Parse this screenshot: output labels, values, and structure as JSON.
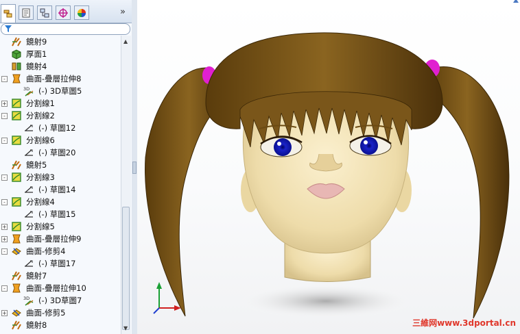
{
  "feature_tree": {
    "tabs": [
      {
        "name": "feature-manager-tab",
        "active": true
      },
      {
        "name": "property-manager-tab",
        "active": false
      },
      {
        "name": "configuration-manager-tab",
        "active": false
      },
      {
        "name": "dimxpert-manager-tab",
        "active": false
      },
      {
        "name": "display-manager-tab",
        "active": false
      }
    ],
    "more_label": "»",
    "items": [
      {
        "label": "鏡射9",
        "icon": "mirror-icon",
        "expander": null,
        "indent": 0
      },
      {
        "label": "厚面1",
        "icon": "thicken-icon",
        "expander": null,
        "indent": 0
      },
      {
        "label": "鏡射4",
        "icon": "mirror-body-icon",
        "expander": null,
        "indent": 0
      },
      {
        "label": "曲面-疊層拉伸8",
        "icon": "surface-loft-icon",
        "expander": "-",
        "indent": 0
      },
      {
        "label": "(-) 3D草圖5",
        "icon": "3d-sketch-icon",
        "expander": null,
        "indent": 1
      },
      {
        "label": "分割線1",
        "icon": "split-line-icon",
        "expander": "+",
        "indent": 0
      },
      {
        "label": "分割線2",
        "icon": "split-line-icon",
        "expander": "-",
        "indent": 0
      },
      {
        "label": "(-) 草圖12",
        "icon": "sketch-icon",
        "expander": null,
        "indent": 1
      },
      {
        "label": "分割線6",
        "icon": "split-line-icon",
        "expander": "-",
        "indent": 0
      },
      {
        "label": "(-) 草圖20",
        "icon": "sketch-icon",
        "expander": null,
        "indent": 1
      },
      {
        "label": "鏡射5",
        "icon": "mirror-icon",
        "expander": null,
        "indent": 0
      },
      {
        "label": "分割線3",
        "icon": "split-line-icon",
        "expander": "-",
        "indent": 0
      },
      {
        "label": "(-) 草圖14",
        "icon": "sketch-icon",
        "expander": null,
        "indent": 1
      },
      {
        "label": "分割線4",
        "icon": "split-line-icon",
        "expander": "-",
        "indent": 0
      },
      {
        "label": "(-) 草圖15",
        "icon": "sketch-icon",
        "expander": null,
        "indent": 1
      },
      {
        "label": "分割線5",
        "icon": "split-line-icon",
        "expander": "+",
        "indent": 0
      },
      {
        "label": "曲面-疊層拉伸9",
        "icon": "surface-loft-icon",
        "expander": "+",
        "indent": 0
      },
      {
        "label": "曲面-修剪4",
        "icon": "surface-trim-icon",
        "expander": "-",
        "indent": 0
      },
      {
        "label": "(-) 草圖17",
        "icon": "sketch-icon",
        "expander": null,
        "indent": 1
      },
      {
        "label": "鏡射7",
        "icon": "mirror-icon",
        "expander": null,
        "indent": 0
      },
      {
        "label": "曲面-疊層拉伸10",
        "icon": "surface-loft-icon",
        "expander": "-",
        "indent": 0
      },
      {
        "label": "(-) 3D草圖7",
        "icon": "3d-sketch-icon",
        "expander": null,
        "indent": 1
      },
      {
        "label": "曲面-修剪5",
        "icon": "surface-trim-icon",
        "expander": "+",
        "indent": 0
      },
      {
        "label": "鏡射8",
        "icon": "mirror-icon",
        "expander": null,
        "indent": 0
      }
    ]
  },
  "viewport": {
    "model": "doll-head-with-pigtails",
    "colors": {
      "hair": "#6b4a12",
      "skin": "#f1e2b5",
      "eyes": "#1a22c8",
      "hair_ties": "#e020d0",
      "lips": "#e8b7b4"
    },
    "watermark": "三維网www.3dportal.cn"
  }
}
